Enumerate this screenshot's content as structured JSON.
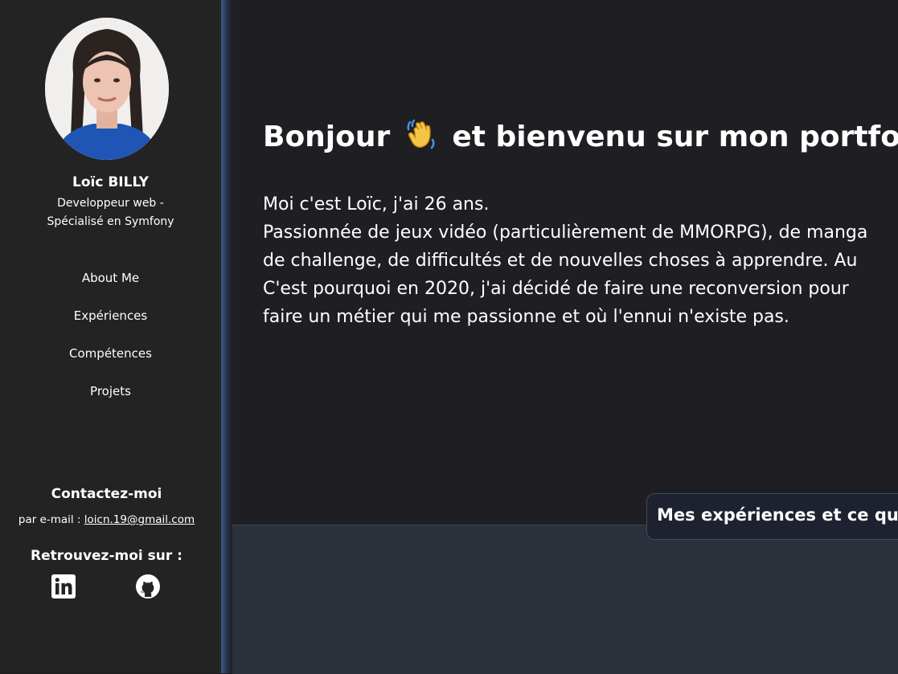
{
  "profile": {
    "name": "Loïc BILLY",
    "role_line1": "Developpeur web -",
    "role_line2": "Spécialisé en Symfony"
  },
  "nav": {
    "about": "About Me",
    "experiences": "Expériences",
    "skills": "Compétences",
    "projects": "Projets"
  },
  "contact": {
    "title": "Contactez-moi",
    "email_prefix": "par e-mail : ",
    "email": "loicn.19@gmail.com"
  },
  "social": {
    "title": "Retrouvez-moi sur :",
    "icons": [
      "linkedin-icon",
      "github-icon"
    ]
  },
  "main": {
    "title_before": "Bonjour",
    "title_after": "et bienvenu sur mon portfolio",
    "intro_lines": [
      "Moi c'est Loïc, j'ai 26 ans.",
      "Passionnée de jeux vidéo (particulièrement de MMORPG), de manga",
      "de challenge, de difficultés et de nouvelles choses à apprendre. Au",
      "C'est pourquoi en 2020, j'ai décidé de faire une reconversion pour",
      "faire un métier qui me passionne et où l'ennui n'existe pas."
    ],
    "experiences_card": "Mes expériences et ce qu"
  },
  "colors": {
    "sidebar_bg": "#232323",
    "main_bg": "#1f1f23",
    "accent": "#3d5a86",
    "bottom_bg": "#2b313b"
  }
}
